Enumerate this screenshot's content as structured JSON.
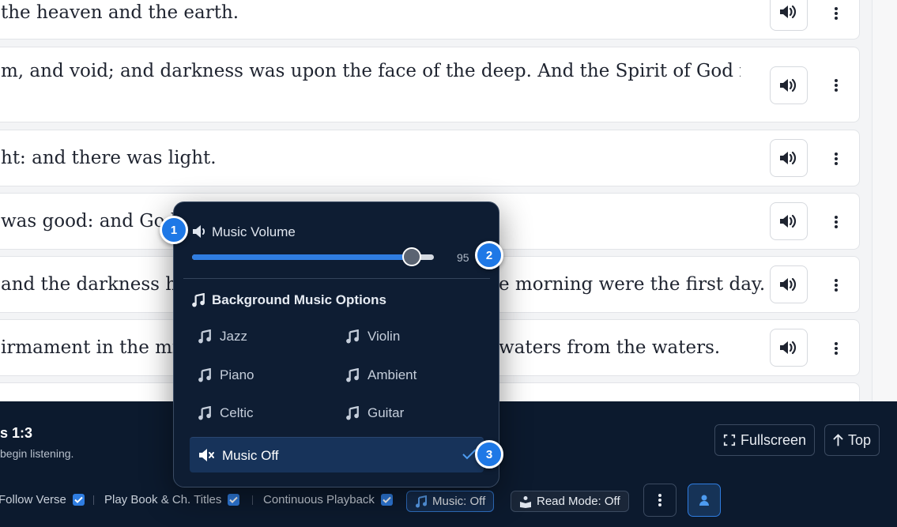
{
  "verses": [
    {
      "text": "the heaven and the earth.",
      "line2": ""
    },
    {
      "text": "m, and void; and darkness was upon the face of the deep. And the Spirit of God moved",
      "line2": ""
    },
    {
      "text": "ht: and there was light.",
      "line2": ""
    },
    {
      "text": "was good: and God",
      "line2": ""
    },
    {
      "text": "and the darkness he",
      "tail": "e morning were the first day."
    },
    {
      "text": "irmament in the mid",
      "tail": "waters from the waters."
    }
  ],
  "colors": {
    "accent": "#2f7de1",
    "bar_bg": "#0c1a2e",
    "popup_bg": "#0e1d33",
    "badge": "#1e78e6"
  },
  "icons": {
    "speak": "speaker-wave-icon",
    "more": "kebab-icon",
    "note": "music-note-icon",
    "mute": "speaker-mute-icon"
  },
  "bottom_bar": {
    "reference": "s 1:3",
    "hint": "begin listening.",
    "fullscreen_label": "Fullscreen",
    "top_label": "Top",
    "options": {
      "follow_verse": "Follow Verse",
      "play_titles": "Play Book & Ch. Titles",
      "continuous": "Continuous Playback"
    },
    "music_pill": "Music: Off",
    "read_mode_pill": "Read Mode: Off"
  },
  "popup": {
    "volume_label": "Music Volume",
    "volume_value_text": "95",
    "volume_level": 0.91,
    "heading": "Background Music Options",
    "options": [
      "Jazz",
      "Violin",
      "Piano",
      "Ambient",
      "Celtic",
      "Guitar"
    ],
    "music_off_label": "Music Off"
  },
  "badges": [
    "1",
    "2",
    "3"
  ]
}
